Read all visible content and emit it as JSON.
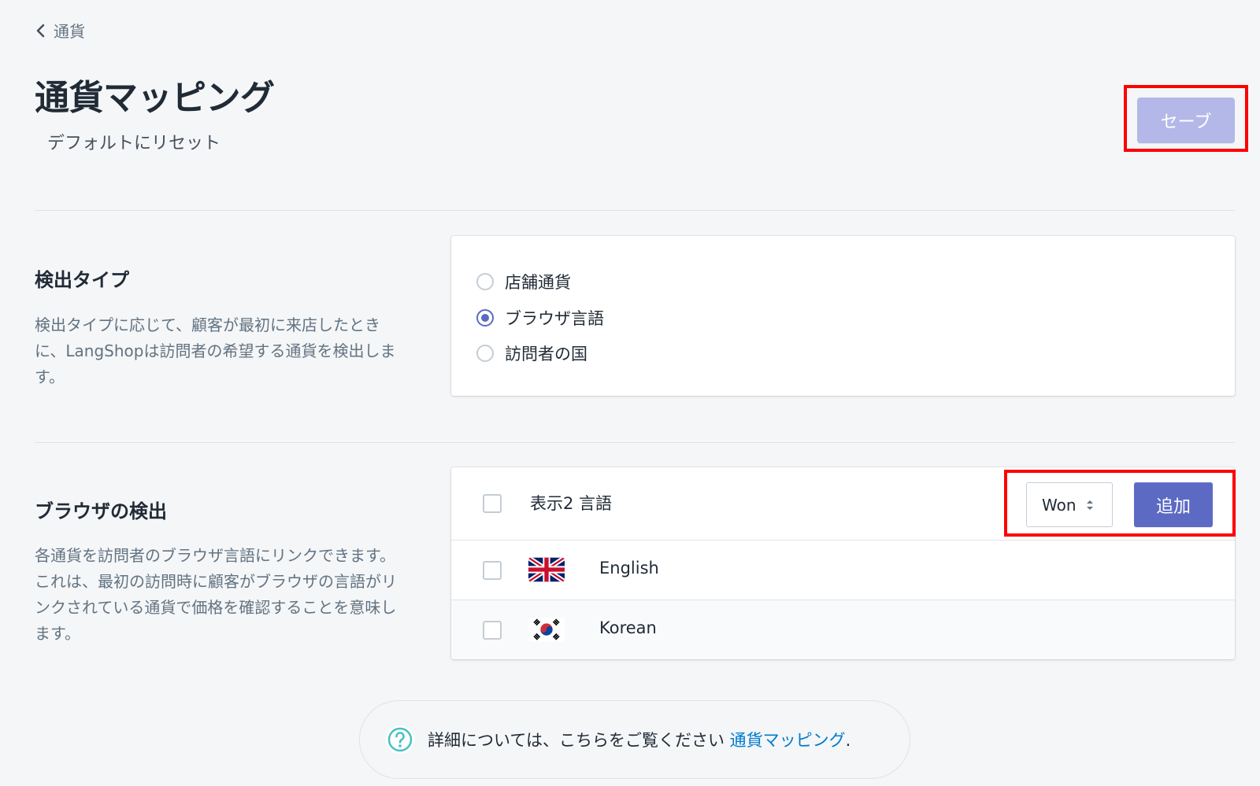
{
  "breadcrumb": {
    "label": "通貨"
  },
  "header": {
    "title": "通貨マッピング",
    "reset_label": "デフォルトにリセット",
    "save_label": "セーブ"
  },
  "detection_type": {
    "title": "検出タイプ",
    "description": "検出タイプに応じて、顧客が最初に来店したときに、LangShopは訪問者の希望する通貨を検出します。",
    "options": [
      {
        "label": "店舗通貨",
        "checked": false
      },
      {
        "label": "ブラウザ言語",
        "checked": true
      },
      {
        "label": "訪問者の国",
        "checked": false
      }
    ]
  },
  "browser_detection": {
    "title": "ブラウザの検出",
    "description": "各通貨を訪問者のブラウザ言語にリンクできます。これは、最初の訪問時に顧客がブラウザの言語がリンクされている通貨で価格を確認することを意味します。",
    "list_header": "表示2 言語",
    "currency_select": "Won",
    "add_label": "追加",
    "languages": [
      {
        "label": "English",
        "flag": "uk-flag-icon"
      },
      {
        "label": "Korean",
        "flag": "korea-flag-icon"
      }
    ]
  },
  "help": {
    "text": "詳細については、こちらをご覧ください",
    "link": "通貨マッピング",
    "suffix": "."
  },
  "colors": {
    "accent": "#5c6ac4",
    "save_disabled": "#b3b8e8",
    "link": "#007ace",
    "help_icon": "#47c1bf",
    "highlight": "#ff0000"
  }
}
